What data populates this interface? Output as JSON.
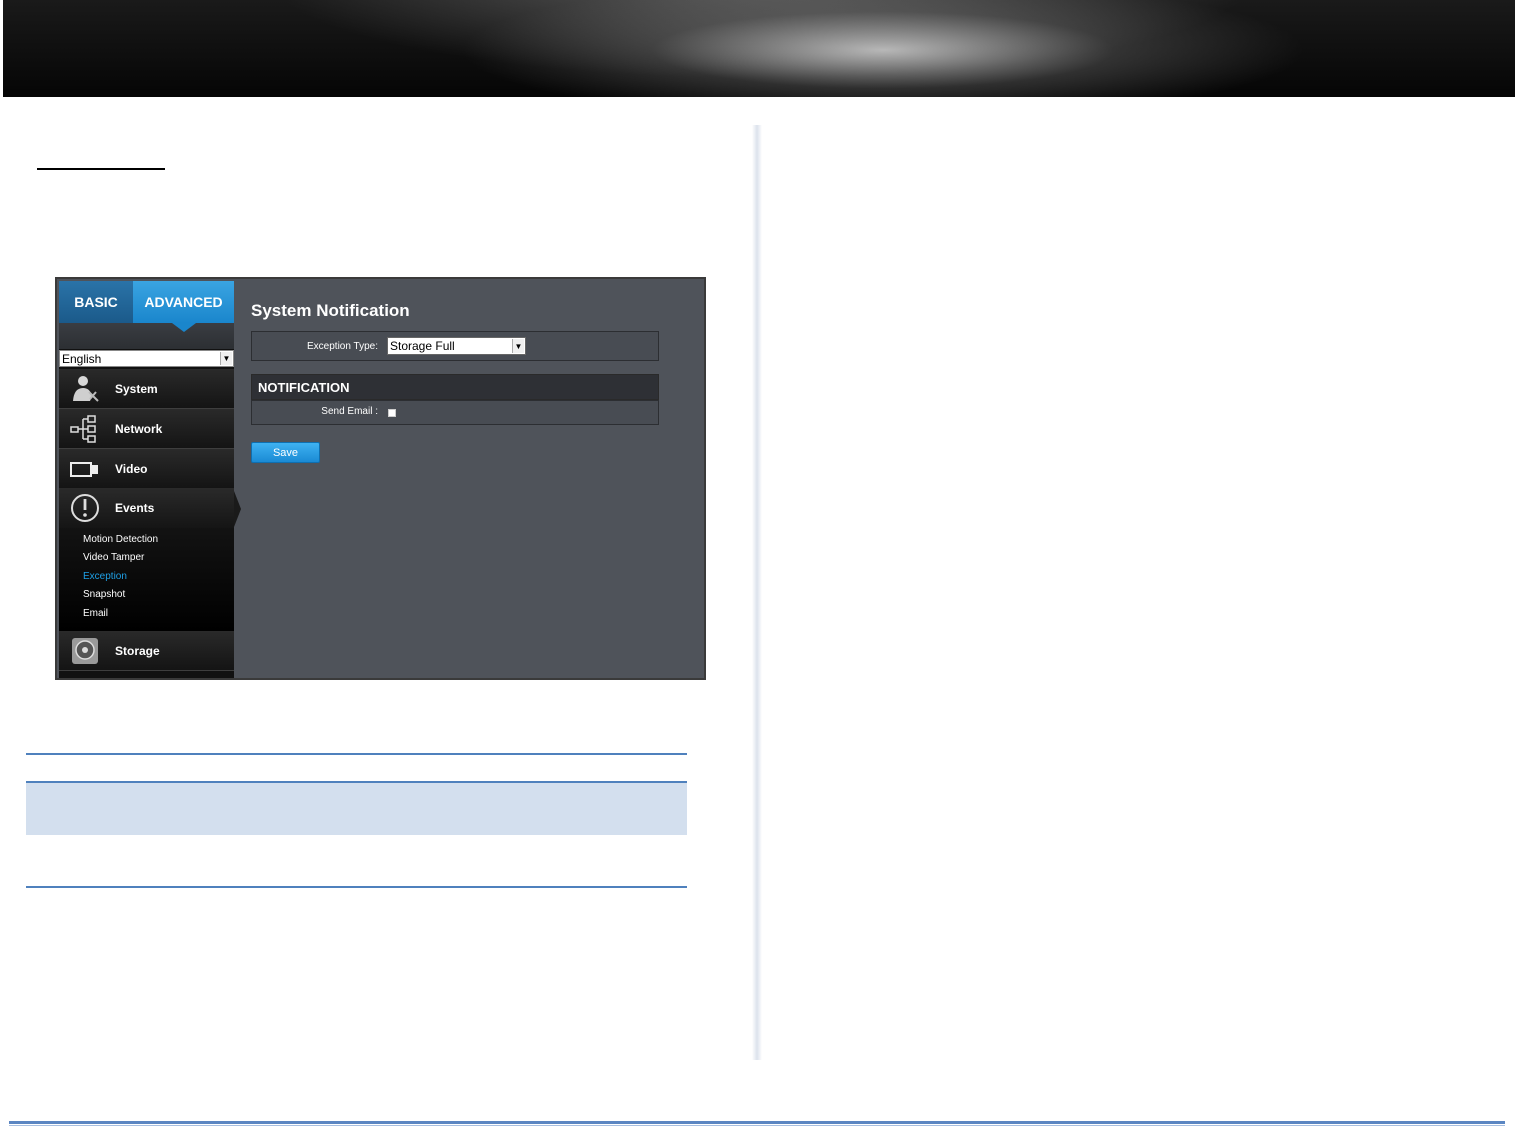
{
  "ui": {
    "tabs": {
      "basic": "BASIC",
      "advanced": "ADVANCED"
    },
    "language": "English",
    "nav": [
      {
        "label": "System",
        "icon": "system-icon"
      },
      {
        "label": "Network",
        "icon": "network-icon"
      },
      {
        "label": "Video",
        "icon": "video-icon"
      },
      {
        "label": "Events",
        "icon": "events-icon"
      },
      {
        "label": "Storage",
        "icon": "storage-icon"
      }
    ],
    "events_sub": [
      "Motion Detection",
      "Video Tamper",
      "Exception",
      "Snapshot",
      "Email"
    ],
    "active_sub": "Exception",
    "title": "System Notification",
    "exception_label": "Exception Type:",
    "exception_value": "Storage Full",
    "notification_header": "NOTIFICATION",
    "send_email_label": "Send Email :",
    "send_email_checked": false,
    "save_label": "Save"
  },
  "colors": {
    "accent": "#1a86cc",
    "active_sub": "#1ea0e6",
    "table_band": "#d3dfee",
    "rule": "#4f81bd"
  }
}
